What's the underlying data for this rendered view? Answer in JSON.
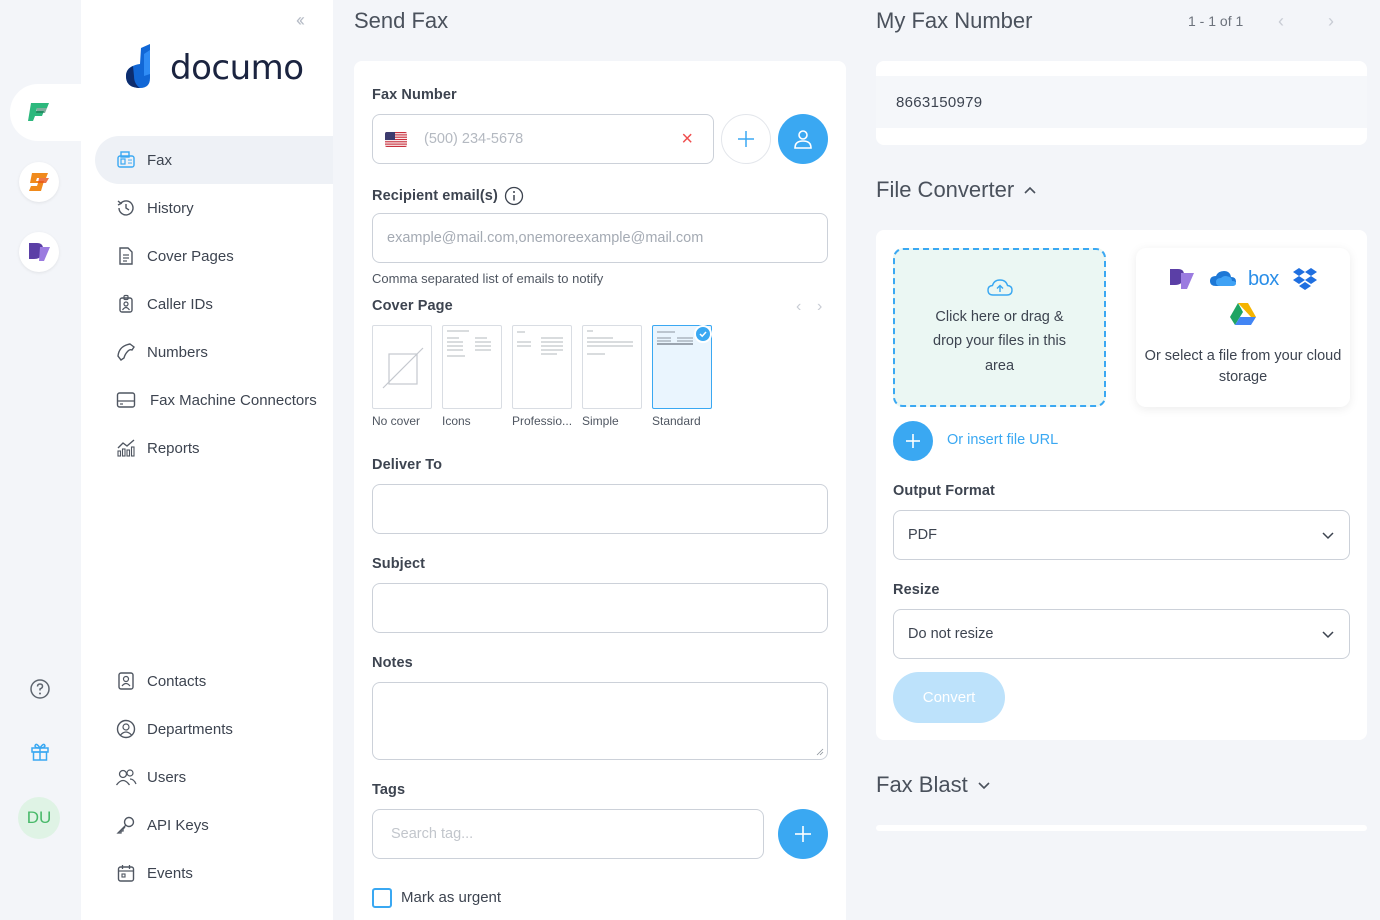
{
  "rail": {
    "avatar_initials": "DU"
  },
  "sidebar": {
    "brand": "documo",
    "nav_top": [
      {
        "label": "Fax",
        "icon": "fax-icon",
        "active": true
      },
      {
        "label": "History",
        "icon": "history-icon"
      },
      {
        "label": "Cover Pages",
        "icon": "cover-pages-icon"
      },
      {
        "label": "Caller IDs",
        "icon": "caller-id-icon"
      },
      {
        "label": "Numbers",
        "icon": "phone-icon"
      },
      {
        "label": "Fax Machine Connectors",
        "icon": "connector-icon"
      },
      {
        "label": "Reports",
        "icon": "reports-icon"
      }
    ],
    "nav_bottom": [
      {
        "label": "Contacts",
        "icon": "contacts-icon"
      },
      {
        "label": "Departments",
        "icon": "departments-icon"
      },
      {
        "label": "Users",
        "icon": "users-icon"
      },
      {
        "label": "API Keys",
        "icon": "key-icon"
      },
      {
        "label": "Events",
        "icon": "events-icon"
      }
    ]
  },
  "send_fax": {
    "title": "Send Fax",
    "fax_number_label": "Fax Number",
    "fax_number_placeholder": "(500) 234-5678",
    "recipient_label": "Recipient email(s)",
    "recipient_placeholder": "example@mail.com,onemoreexample@mail.com",
    "recipient_hint": "Comma separated list of emails to notify",
    "cover_page_label": "Cover Page",
    "covers": [
      "No cover",
      "Icons",
      "Professio...",
      "Simple",
      "Standard"
    ],
    "selected_cover": "Standard",
    "deliver_to_label": "Deliver To",
    "subject_label": "Subject",
    "notes_label": "Notes",
    "tags_label": "Tags",
    "tags_placeholder": "Search tag...",
    "urgent_label": "Mark as urgent"
  },
  "my_fax": {
    "title": "My Fax Number",
    "pager": "1 - 1 of 1",
    "number": "8663150979"
  },
  "file_converter": {
    "title": "File Converter",
    "dropzone_text": "Click here or drag & drop your files in this area",
    "cloud_text": "Or select a file from your cloud storage",
    "insert_url": "Or insert file URL",
    "output_format_label": "Output Format",
    "output_format_value": "PDF",
    "resize_label": "Resize",
    "resize_value": "Do not resize",
    "convert_label": "Convert"
  },
  "fax_blast": {
    "title": "Fax Blast"
  },
  "colors": {
    "accent": "#3aa8f2",
    "convert_disabled": "#bde2fb",
    "dropzone_bg": "#ebf7f3",
    "avatar_bg": "#dff3e5",
    "avatar_text": "#48b969"
  }
}
